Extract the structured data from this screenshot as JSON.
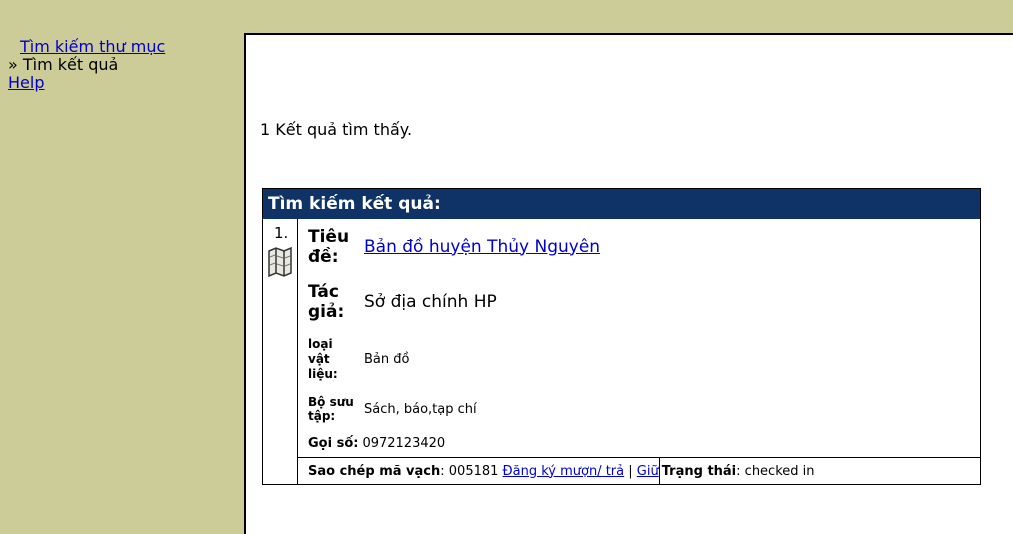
{
  "sidebar": {
    "search_link": "Tìm kiếm thư mục",
    "current": "» Tìm kết quả",
    "help_link": "Help"
  },
  "main": {
    "result_count_text": "1 Kết quả tìm thấy."
  },
  "results": {
    "header": "Tìm kiếm kết quả:",
    "record": {
      "number": "1.",
      "icon": "map-icon",
      "title_label": "Tiêu đề:",
      "title_value": "Bản đồ huyện Thủy Nguyên",
      "author_label": "Tác giả:",
      "author_value": "Sở địa chính HP",
      "type_label": "loại vật liệu:",
      "type_value": "Bản đồ",
      "collection_label": "Bộ sưu tập:",
      "collection_value": "Sách, báo,tạp chí",
      "call_label": "Gọi số:",
      "call_value": "0972123420",
      "barcode_label": "Sao chép mã vạch",
      "barcode_value": ": 005181",
      "borrow_link": "Đăng ký mượn/ trả",
      "separator": "|",
      "hold_link": "Giữ",
      "status_label": "Trạng thái",
      "status_value": ": checked in"
    }
  },
  "colors": {
    "sidebar_bg": "#cccc99",
    "header_bg": "#0f3366",
    "link": "#0000cc"
  }
}
